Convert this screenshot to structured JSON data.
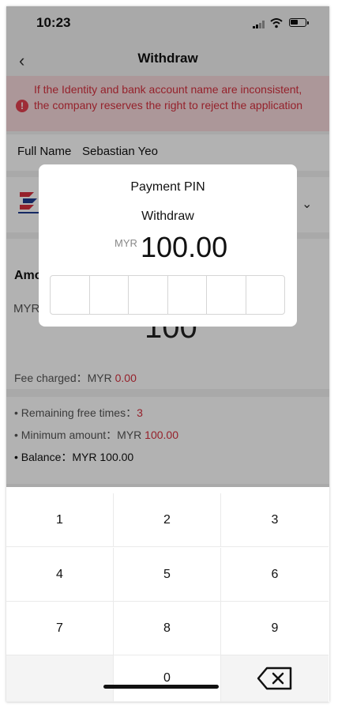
{
  "status_bar": {
    "time": "10:23"
  },
  "header": {
    "title": "Withdraw",
    "back_icon": "chevron-left-icon"
  },
  "warning": {
    "icon": "exclamation-icon",
    "text": "If the Identity and bank account name are inconsistent, the company reserves the right to reject the application"
  },
  "account": {
    "full_name_label": "Full Name",
    "full_name_value": "Sebastian Yeo"
  },
  "bank": {
    "logo": "bank-logo",
    "chevron": "chevron-down-icon"
  },
  "amount": {
    "label": "Amo",
    "currency": "MYR",
    "value": "100",
    "fee_label": "Fee charged：MYR ",
    "fee_value": "0.00"
  },
  "info": {
    "remaining_label": "• Remaining free times：",
    "remaining_value": "3",
    "minimum_label": "• Minimum amount：MYR ",
    "minimum_value": "100.00",
    "balance": "• Balance：MYR 100.00"
  },
  "modal": {
    "title": "Payment PIN",
    "subtitle": "Withdraw",
    "currency": "MYR",
    "amount": "100.00",
    "pin_slots": 6
  },
  "keypad": {
    "keys": [
      "1",
      "2",
      "3",
      "4",
      "5",
      "6",
      "7",
      "8",
      "9",
      "0"
    ],
    "delete_icon": "backspace-icon"
  },
  "colors": {
    "accent_red": "#d6303e",
    "warning_bg": "#f6d9dc"
  }
}
